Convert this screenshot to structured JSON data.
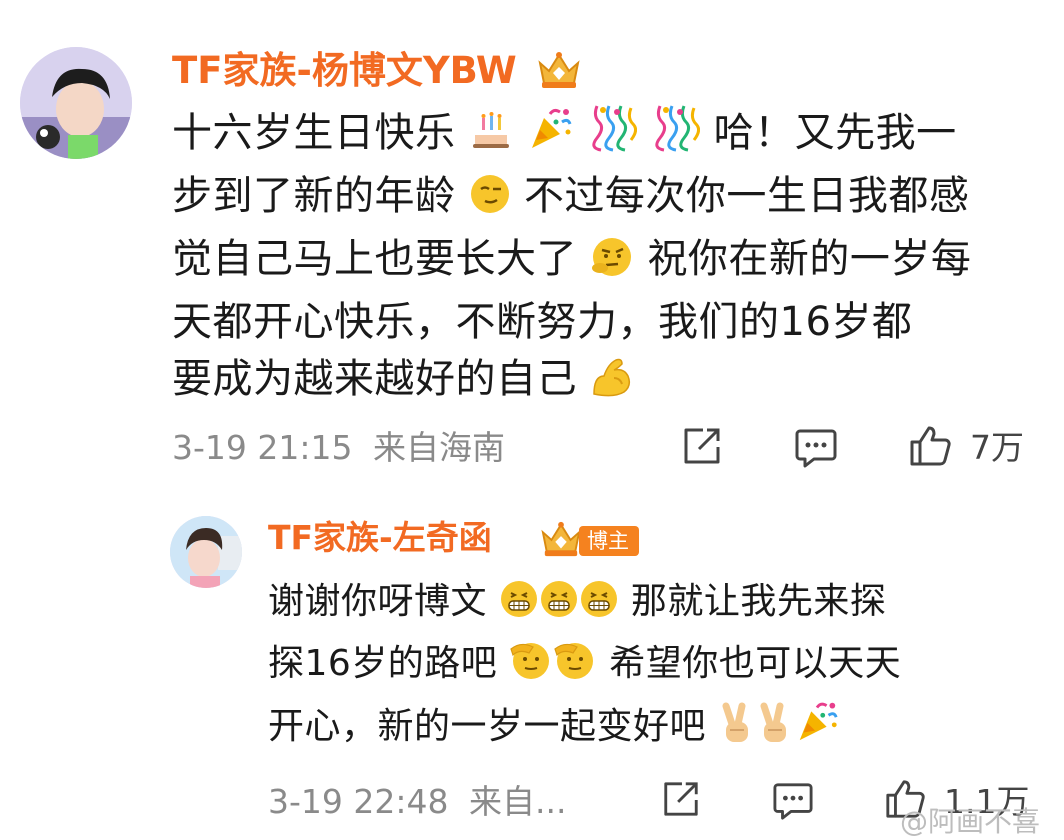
{
  "comment": {
    "username": "TF家族-杨博文YBW",
    "lines": [
      "十六岁生日快乐",
      "哈！又先我一",
      "步到了新的年龄",
      "不过每次你一生日我都感",
      "觉自己马上也要长大了",
      "祝你在新的一岁每",
      "天都开心快乐，不断努力，我们的16岁都",
      "要成为越来越好的自己"
    ],
    "emoji": [
      "cake-emoji",
      "party-popper-emoji",
      "confetti-emoji",
      "confetti-emoji",
      "wink-emoji",
      "thinking-emoji",
      "flexed-biceps-emoji"
    ],
    "time": "3-19 21:15",
    "location": "来自海南",
    "like_count": "7万"
  },
  "reply": {
    "username": "TF家族-左奇函",
    "blogger_tag": "博主",
    "lines": [
      "谢谢你呀博文",
      "那就让我先来探",
      "探16岁的路吧",
      "希望你也可以天天",
      "开心，新的一岁一起变好吧"
    ],
    "emoji": [
      "grin-emoji",
      "grin-emoji",
      "grin-emoji",
      "salute-emoji",
      "salute-emoji",
      "victory-hand-emoji",
      "victory-hand-emoji",
      "party-popper-emoji"
    ],
    "time": "3-19 22:48",
    "location": "来自...",
    "like_count": "1.1万"
  },
  "watermark": "@阿画不喜",
  "colors": {
    "username": "#f26a22",
    "meta": "#8a8a8a",
    "blogger_tag_bg": "#f5821f"
  }
}
